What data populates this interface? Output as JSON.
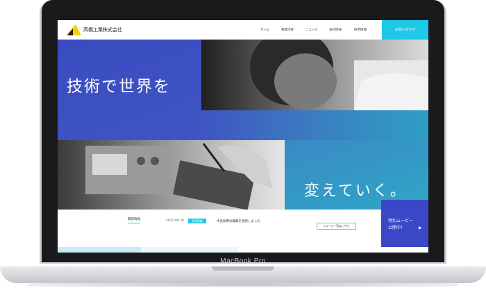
{
  "device": {
    "label": "MacBook Pro"
  },
  "header": {
    "company": "高橋工業株式会社",
    "nav": [
      "ホーム",
      "事業内容",
      "ニュース",
      "会社情報",
      "採用情報"
    ],
    "contact": "お問い合わせ"
  },
  "hero": {
    "line1": "技術で世界を",
    "line2": "変えていく。"
  },
  "news": {
    "title": "最新情報",
    "date": "2021.09.30",
    "badge": "採用情報",
    "text": "中途採用の募集を更新しました",
    "more": "ニュース一覧はこちら"
  },
  "movie": {
    "line1": "特別ムービー",
    "line2": "公開中！",
    "arrow": "▶"
  },
  "colors": {
    "accent": "#1ec8e6",
    "brand_blue": "#3a47c6"
  }
}
